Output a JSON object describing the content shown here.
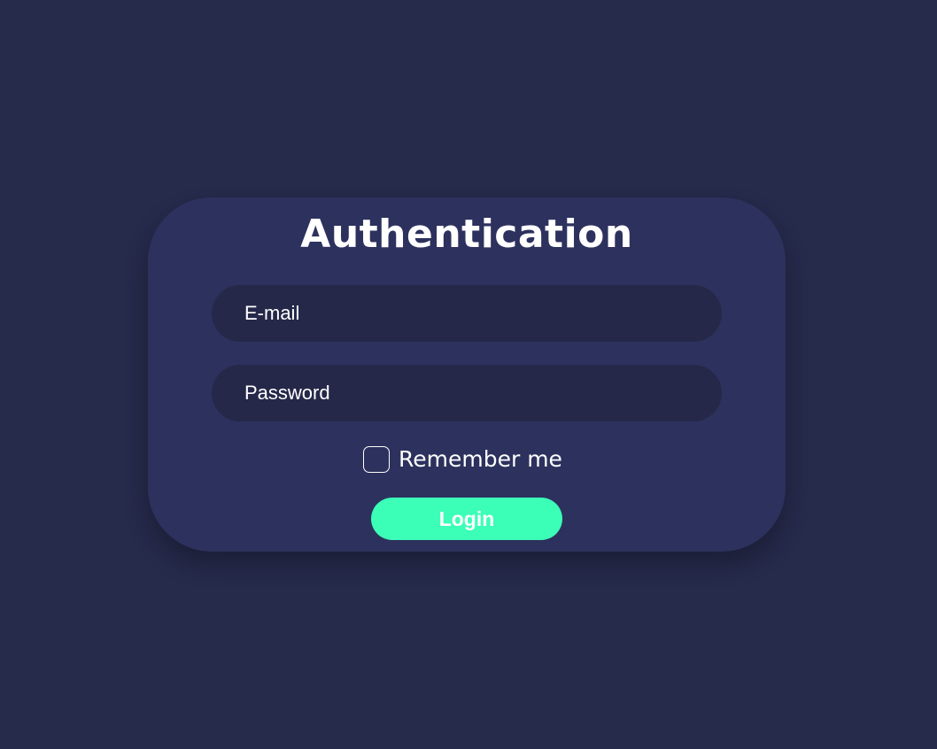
{
  "auth_form": {
    "title": "Authentication",
    "email": {
      "placeholder": "E-mail",
      "value": ""
    },
    "password": {
      "placeholder": "Password",
      "value": ""
    },
    "remember": {
      "label": "Remember me",
      "checked": false
    },
    "login_label": "Login"
  },
  "colors": {
    "page_background": "#262a4b",
    "card_background": "#2d315d",
    "field_background": "#252849",
    "accent": "#3bffb7",
    "text": "#ffffff"
  }
}
